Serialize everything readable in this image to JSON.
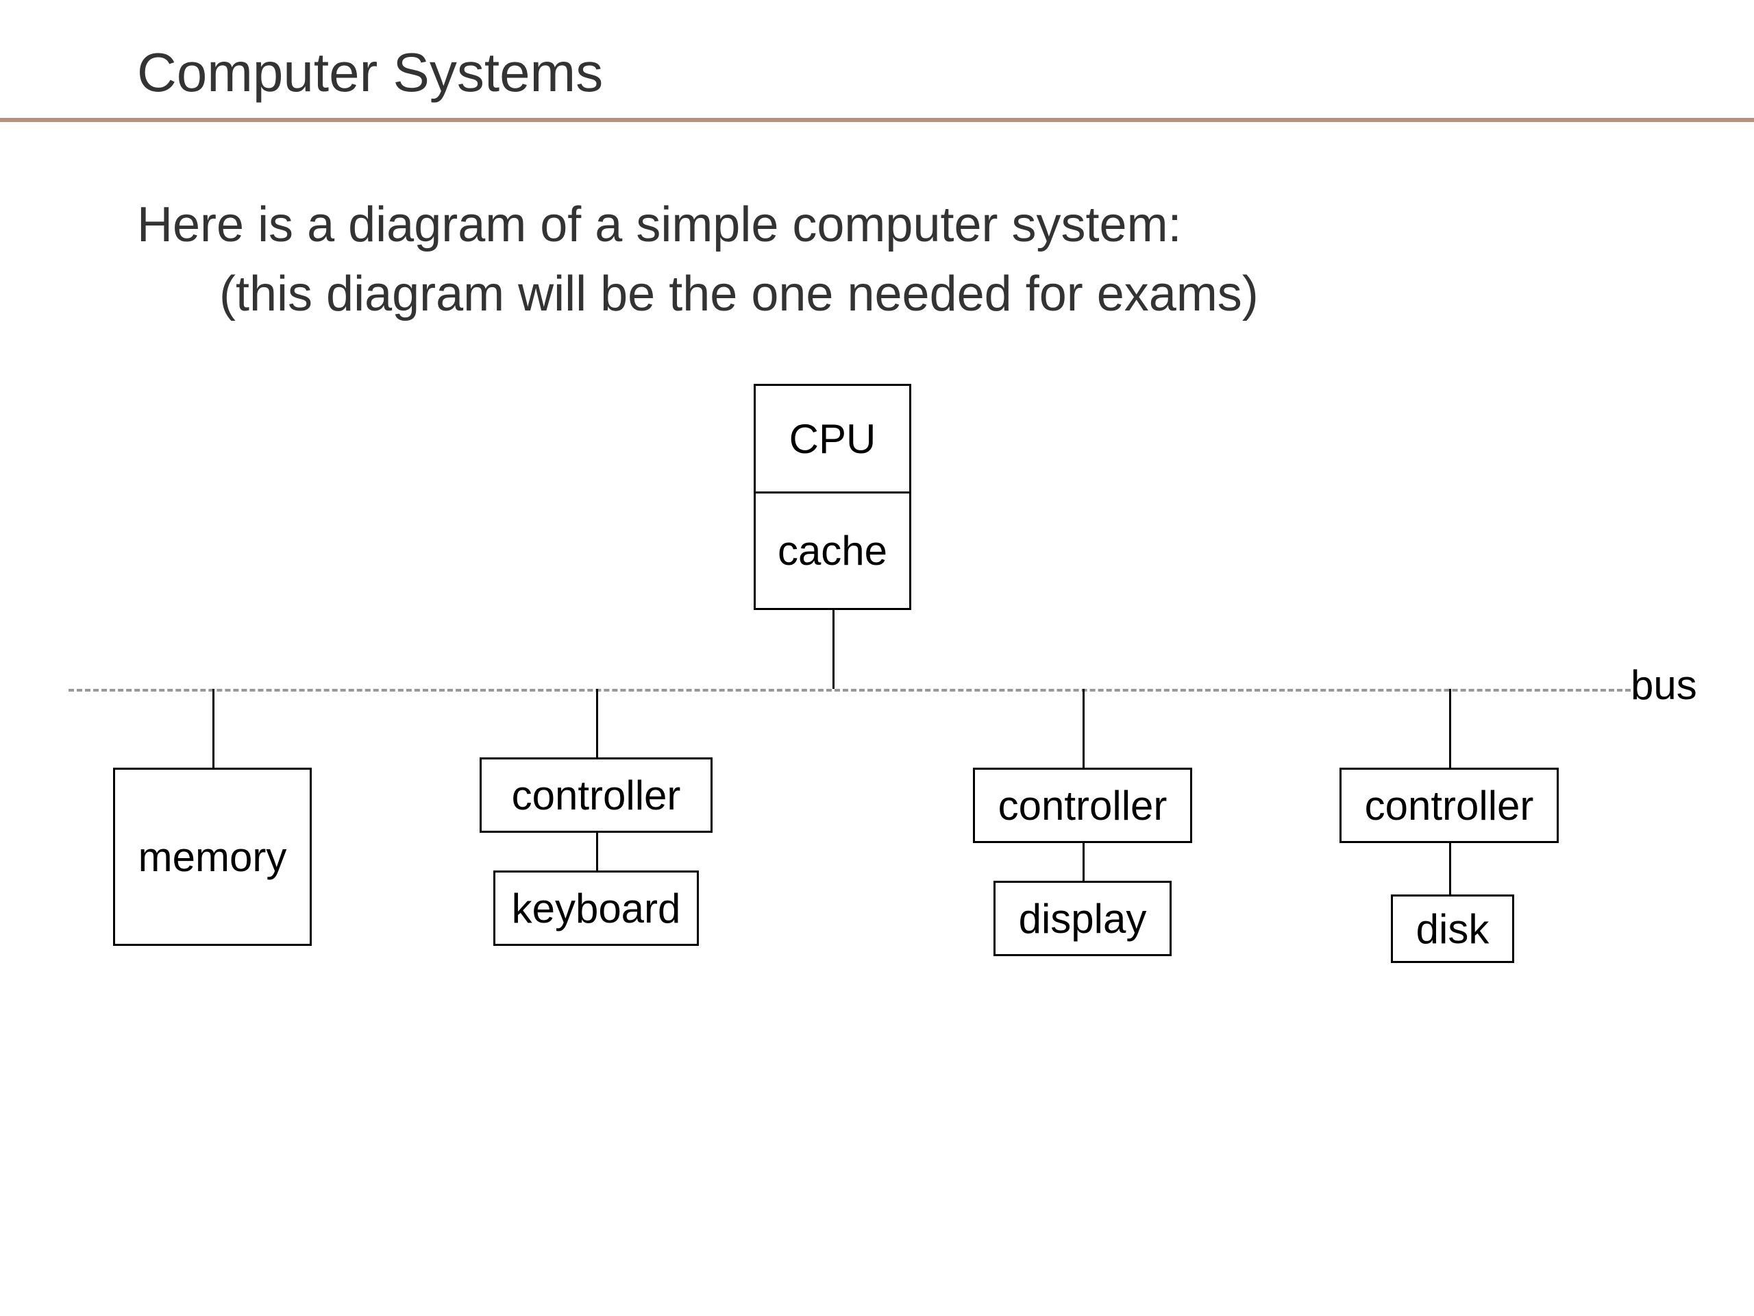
{
  "title": "Computer Systems",
  "body": {
    "line1": "Here is a diagram of a simple computer system:",
    "line2": "(this diagram will be the one needed for exams)"
  },
  "diagram": {
    "cpu": "CPU",
    "cache": "cache",
    "bus": "bus",
    "memory": "memory",
    "controller1": "controller",
    "keyboard": "keyboard",
    "controller2": "controller",
    "display": "display",
    "controller3": "controller",
    "disk": "disk"
  }
}
